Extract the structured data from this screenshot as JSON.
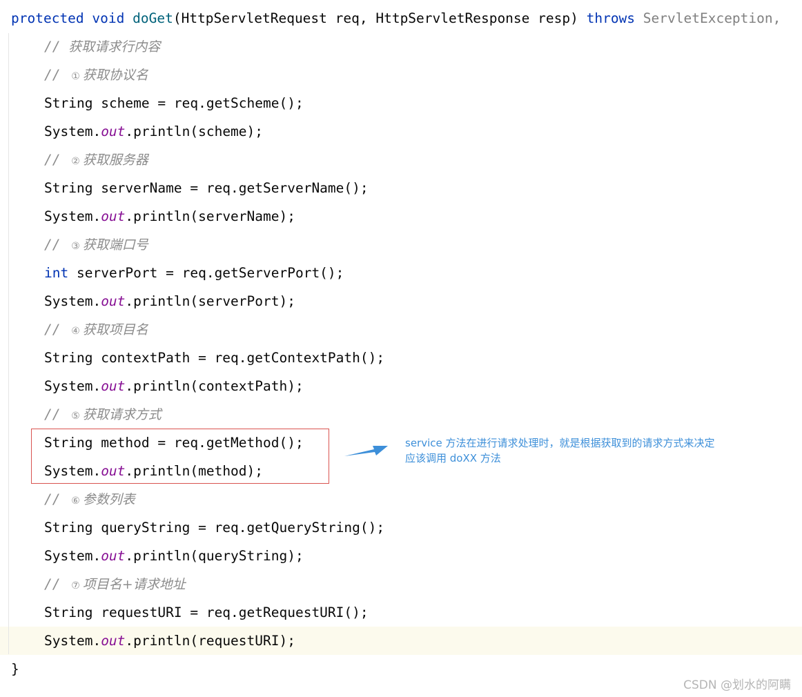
{
  "code": {
    "signature": {
      "modifier": "protected",
      "return_type": "void",
      "method_name": "doGet",
      "params": "(HttpServletRequest req, HttpServletResponse resp) ",
      "throws_kw": "throws",
      "exception": "ServletException,"
    },
    "lines": [
      {
        "type": "comment",
        "text": "获取请求行内容"
      },
      {
        "type": "comment",
        "marker": "①",
        "text": "获取协议名"
      },
      {
        "type": "decl",
        "decl_type": "String",
        "rest": "scheme = req.getScheme();"
      },
      {
        "type": "print",
        "arg": "scheme"
      },
      {
        "type": "comment",
        "marker": "②",
        "text": "获取服务器"
      },
      {
        "type": "decl",
        "decl_type": "String",
        "rest": "serverName = req.getServerName();"
      },
      {
        "type": "print",
        "arg": "serverName"
      },
      {
        "type": "comment",
        "marker": "③",
        "text": "获取端口号"
      },
      {
        "type": "decl",
        "decl_type": "int",
        "keyword": true,
        "rest": "serverPort = req.getServerPort();"
      },
      {
        "type": "print",
        "arg": "serverPort"
      },
      {
        "type": "comment",
        "marker": "④",
        "text": "获取项目名"
      },
      {
        "type": "decl",
        "decl_type": "String",
        "rest": "contextPath = req.getContextPath();"
      },
      {
        "type": "print",
        "arg": "contextPath"
      },
      {
        "type": "comment",
        "marker": "⑤",
        "text": "获取请求方式"
      },
      {
        "type": "decl",
        "decl_type": "String",
        "rest": "method = req.getMethod();"
      },
      {
        "type": "print",
        "arg": "method"
      },
      {
        "type": "comment",
        "marker": "⑥",
        "text": "参数列表"
      },
      {
        "type": "decl",
        "decl_type": "String",
        "rest": "queryString = req.getQueryString();"
      },
      {
        "type": "print",
        "arg": "queryString"
      },
      {
        "type": "comment",
        "marker": "⑦",
        "text": "项目名+请求地址"
      },
      {
        "type": "decl",
        "decl_type": "String",
        "rest": "requestURI = req.getRequestURI();"
      },
      {
        "type": "print",
        "arg": "requestURI"
      }
    ],
    "closing_brace": "}"
  },
  "syntax": {
    "comment_prefix": "//",
    "print_prefix": "System.",
    "print_field": "out",
    "print_method": ".println(",
    "print_suffix": ");"
  },
  "annotation": {
    "line1": "service  方法在进行请求处理时，就是根据获取到的请求方式来决定",
    "line2": "应该调用 doXX 方法"
  },
  "watermark": "CSDN @划水的阿瞒",
  "colors": {
    "keyword": "#0033b3",
    "method_decl": "#00627a",
    "static_field": "#871094",
    "comment": "#8c8c8c",
    "box_border": "#d9534f",
    "annotation_text": "#3d8fd9",
    "caret_row": "#fcfaed"
  }
}
